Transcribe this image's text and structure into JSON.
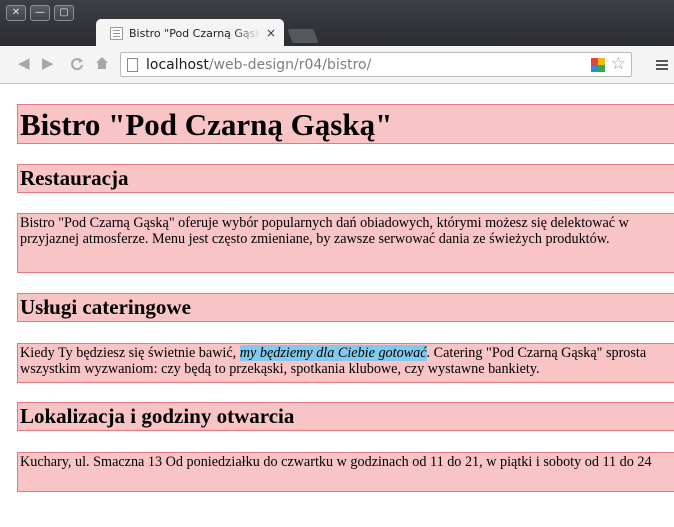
{
  "browser": {
    "tab": {
      "title": "Bistro \"Pod Czarną Gąską\"",
      "close": "×"
    },
    "address_bar": {
      "host": "localhost",
      "path": "/web-design/r04/bistro/"
    },
    "icons": [
      "close-window-icon",
      "minimize-window-icon",
      "maximize-window-icon",
      "back-icon",
      "forward-icon",
      "reload-icon",
      "home-icon",
      "page-icon",
      "star-icon",
      "menu-icon"
    ]
  },
  "page": {
    "heading": "Bistro \"Pod Czarną Gąską\"",
    "sections": [
      {
        "title": "Restauracja",
        "text": "Bistro \"Pod Czarną Gąską\" oferuje wybór popularnych dań obiadowych, którymi możesz się delektować w przyjaznej atmosferze. Menu jest często zmieniane, by zawsze serwować dania ze świeżych produktów."
      },
      {
        "title": "Usługi cateringowe",
        "text_before": "Kiedy Ty będziesz się świetnie bawić, ",
        "text_highlight": "my będziemy dla Ciebie gotować",
        "text_after": ". Catering \"Pod Czarną Gąską\" sprosta wszystkim wyzwaniom: czy będą to przekąski, spotkania klubowe, czy wystawne bankiety."
      },
      {
        "title": "Lokalizacja i godziny otwarcia",
        "text": "Kuchary, ul. Smaczna 13 Od poniedziałku do czwartku w godzinach od 11 do 21, w piątki i soboty od 11 do 24"
      }
    ]
  },
  "colors": {
    "block_background": "#f8c4c6",
    "block_border": "#e27a80",
    "highlight": "#82c9ee"
  }
}
